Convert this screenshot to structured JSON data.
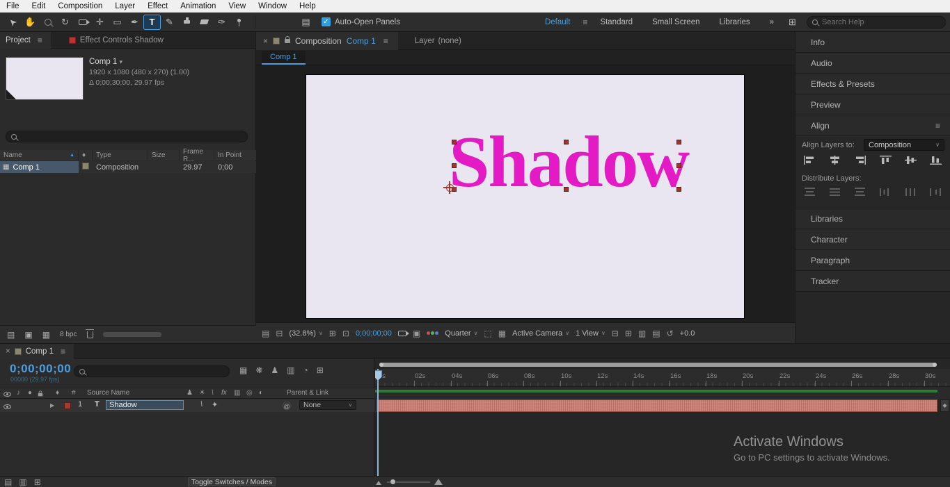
{
  "icons": {
    "hamburger": "≡",
    "close": "×",
    "overflow": "»",
    "chevron_down": "∨",
    "dropdown_arrow": "▾",
    "sort_asc": "▲",
    "expander": "▶",
    "at": "@",
    "check": "✓",
    "selection_tool": "➤",
    "hand_tool": "✋",
    "rotation_tool": "↻",
    "pan_behind_tool": "✛",
    "rectangle_tool": "▭",
    "pen_tool": "✒",
    "type_tool": "T",
    "brush_tool": "✎",
    "roto_brush_tool": "✑"
  },
  "menu_bar": {
    "items": [
      "File",
      "Edit",
      "Composition",
      "Layer",
      "Effect",
      "Animation",
      "View",
      "Window",
      "Help"
    ]
  },
  "toolbar": {
    "auto_open_panels": "Auto-Open Panels",
    "workspaces": {
      "default": "Default",
      "standard": "Standard",
      "small_screen": "Small Screen",
      "libraries": "Libraries"
    },
    "search_placeholder": "Search Help"
  },
  "project_panel": {
    "tab_project": "Project",
    "tab_effect_controls": "Effect Controls Shadow",
    "comp_name": "Comp 1",
    "comp_dimensions": "1920 x 1080 (480 x 270) (1.00)",
    "comp_duration": "Δ 0;00;30;00, 29.97 fps",
    "columns": {
      "name": "Name",
      "type": "Type",
      "size": "Size",
      "frame_rate": "Frame R...",
      "in_point": "In Point"
    },
    "row": {
      "name": "Comp 1",
      "type": "Composition",
      "frame_rate": "29.97",
      "in_point": "0;00"
    },
    "bit_depth": "8 bpc"
  },
  "composition_panel": {
    "tab_label": "Composition",
    "tab_comp_name": "Comp 1",
    "layer_tab_label": "Layer",
    "layer_tab_value": "(none)",
    "sub_tab": "Comp 1",
    "canvas_text": "Shadow",
    "footer": {
      "zoom": "(32.8%)",
      "timecode": "0;00;00;00",
      "resolution": "Quarter",
      "camera": "Active Camera",
      "view_layout": "1 View",
      "exposure": "+0.0"
    }
  },
  "right_panels": {
    "info": "Info",
    "audio": "Audio",
    "effects_presets": "Effects & Presets",
    "preview": "Preview",
    "align": {
      "title": "Align",
      "align_layers_to": "Align Layers to:",
      "target": "Composition",
      "distribute": "Distribute Layers:"
    },
    "libraries": "Libraries",
    "character": "Character",
    "paragraph": "Paragraph",
    "tracker": "Tracker"
  },
  "timeline": {
    "tab": "Comp 1",
    "timecode": "0;00;00;00",
    "frame_info": "00000 (29.97 fps)",
    "columns": {
      "number": "#",
      "source_name": "Source Name",
      "parent_link": "Parent & Link"
    },
    "layer": {
      "index": "1",
      "type_badge": "T",
      "name": "Shadow",
      "parent": "None"
    },
    "ruler": [
      "0s",
      "02s",
      "04s",
      "06s",
      "08s",
      "10s",
      "12s",
      "14s",
      "16s",
      "18s",
      "20s",
      "22s",
      "24s",
      "26s",
      "28s",
      "30s"
    ],
    "toggle_switches": "Toggle Switches / Modes"
  },
  "watermark": {
    "title": "Activate Windows",
    "subtitle": "Go to PC settings to activate Windows."
  }
}
